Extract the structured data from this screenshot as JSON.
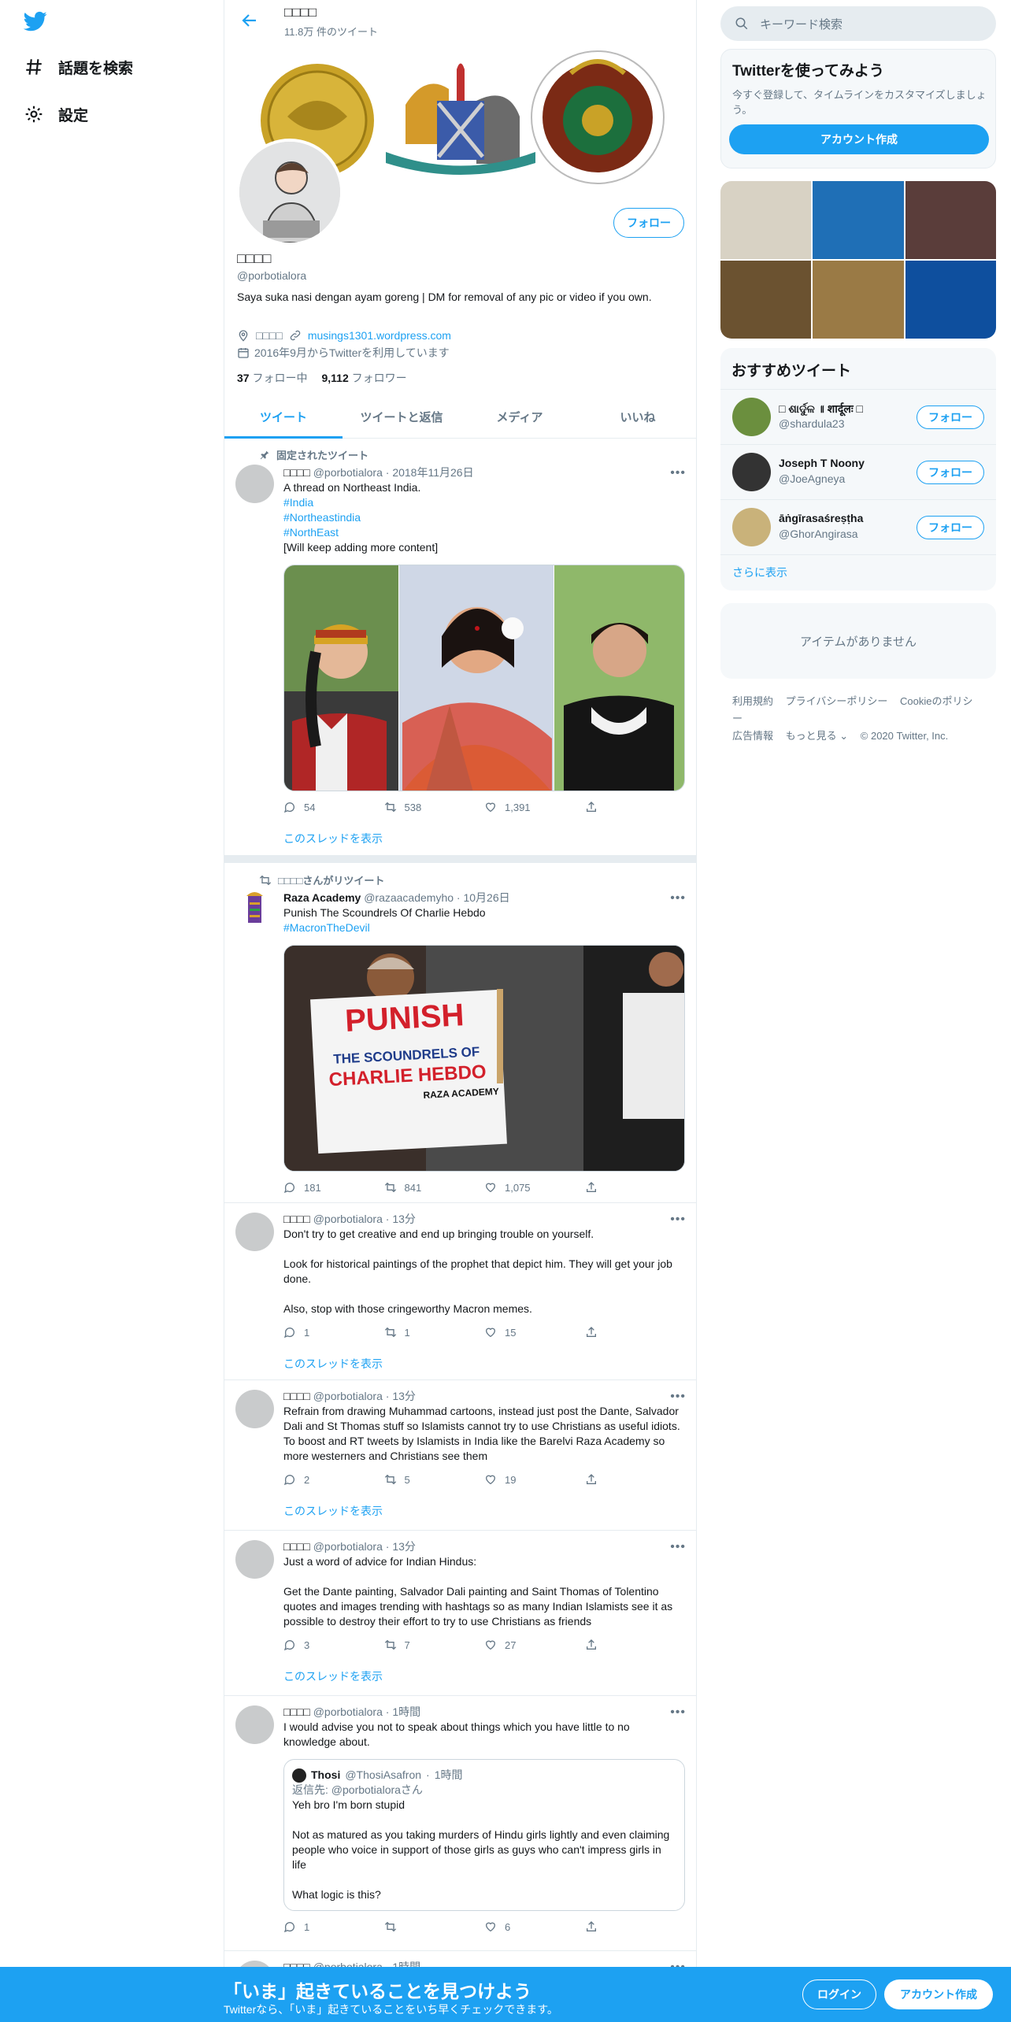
{
  "nav": {
    "explore": "話題を検索",
    "settings": "設定"
  },
  "header": {
    "name": "□□□□",
    "tweet_count": "11.8万 件のツイート"
  },
  "profile": {
    "name": "□□□□",
    "handle": "@porbotialora",
    "follow_label": "フォロー",
    "bio": "Saya suka nasi dengan ayam goreng | DM for removal of any pic or video if you own.",
    "location": "□□□□",
    "website": "musings1301.wordpress.com",
    "joined": "2016年9月からTwitterを利用しています",
    "following_count": "37",
    "following_label": "フォロー中",
    "followers_count": "9,112",
    "followers_label": "フォロワー"
  },
  "tabs": [
    "ツイート",
    "ツイートと返信",
    "メディア",
    "いいね"
  ],
  "tweets": {
    "t1": {
      "context": "固定されたツイート",
      "name": "□□□□",
      "handle": "@porbotialora",
      "time": "2018年11月26日",
      "line1": "A thread on Northeast India.",
      "tag1": "#India",
      "tag2": "#Northeastindia",
      "tag3": "#NorthEast",
      "line2": "[Will keep adding more content]",
      "reply": "54",
      "retweet": "538",
      "like": "1,391",
      "thread": "このスレッドを表示"
    },
    "t2": {
      "context": "□□□□さんがリツイート",
      "name": "Raza Academy",
      "handle": "@razaacademyho",
      "time": "10月26日",
      "line1": "Punish The Scoundrels Of Charlie Hebdo",
      "tag1": "#MacronTheDevil",
      "sign1": "PUNISH",
      "sign2": "THE SCOUNDRELS OF",
      "sign3": "CHARLIE HEBDO",
      "sign4": "RAZA ACADEMY",
      "reply": "181",
      "retweet": "841",
      "like": "1,075"
    },
    "t3": {
      "name": "□□□□",
      "handle": "@porbotialora",
      "time": "13分",
      "p1": "Don't try to get creative and end up bringing trouble on yourself.",
      "p2": "Look for historical paintings of the prophet that depict him. They will get your job done.",
      "p3": "Also, stop with those cringeworthy Macron memes.",
      "reply": "1",
      "retweet": "1",
      "like": "15",
      "thread": "このスレッドを表示"
    },
    "t4": {
      "name": "□□□□",
      "handle": "@porbotialora",
      "time": "13分",
      "p1": "Refrain from drawing Muhammad cartoons, instead just post the Dante, Salvador Dali and St Thomas stuff so Islamists cannot try to use Christians as useful idiots. To boost and RT tweets by Islamists in India like the Barelvi Raza Academy so more westerners and Christians see them",
      "reply": "2",
      "retweet": "5",
      "like": "19",
      "thread": "このスレッドを表示"
    },
    "t5": {
      "name": "□□□□",
      "handle": "@porbotialora",
      "time": "13分",
      "p1": "Just a word of advice for Indian Hindus:",
      "p2": "Get the Dante painting, Salvador Dali painting and Saint Thomas of Tolentino quotes and images trending with hashtags so as many Indian Islamists see it as possible to destroy their effort to try to use Christians as friends",
      "reply": "3",
      "retweet": "7",
      "like": "27",
      "thread": "このスレッドを表示"
    },
    "t6": {
      "name": "□□□□",
      "handle": "@porbotialora",
      "time": "1時間",
      "p1": "I would advise you not to speak about things which you have little to no knowledge about.",
      "quote_name": "Thosi",
      "quote_handle": "@ThosiAsafron",
      "quote_time": "1時間",
      "quote_reply_to": "返信先: @porbotialoraさん",
      "quote_p1": "Yeh bro I'm born stupid",
      "quote_p2": "Not as matured as you taking murders of Hindu girls lightly and even claiming people who voice in support of those girls as guys who can't impress girls in life",
      "quote_p3": "What logic is this?",
      "reply": "1",
      "retweet": "",
      "like": "6"
    },
    "t7": {
      "name": "□□□□",
      "handle": "@porbotialora",
      "time": "1時間"
    }
  },
  "sidebar": {
    "search_placeholder": "キーワード検索",
    "signup_title": "Twitterを使ってみよう",
    "signup_desc": "今すぐ登録して、タイムラインをカスタマイズしましょう。",
    "signup_button": "アカウント作成",
    "rec_title": "おすすめツイート",
    "recs": [
      {
        "name": "□ ଶାର୍ଦୁଳ ॥ शार्दूलः □",
        "handle": "@shardula23",
        "button": "フォロー"
      },
      {
        "name": "Joseph T Noony",
        "handle": "@JoeAgneya",
        "button": "フォロー"
      },
      {
        "name": "āṅgīrasaśreṣṭha",
        "handle": "@GhorAngirasa",
        "button": "フォロー"
      }
    ],
    "more": "さらに表示",
    "empty": "アイテムがありません",
    "footer": [
      "利用規約",
      "プライバシーポリシー",
      "Cookieのポリシー",
      "広告情報",
      "もっと見る ⌄",
      "© 2020 Twitter, Inc."
    ]
  },
  "bottom_bar": {
    "title": "「いま」起きていることを見つけよう",
    "subtitle": "Twitterなら、「いま」起きていることをいち早くチェックできます。",
    "login": "ログイン",
    "signup": "アカウント作成"
  }
}
